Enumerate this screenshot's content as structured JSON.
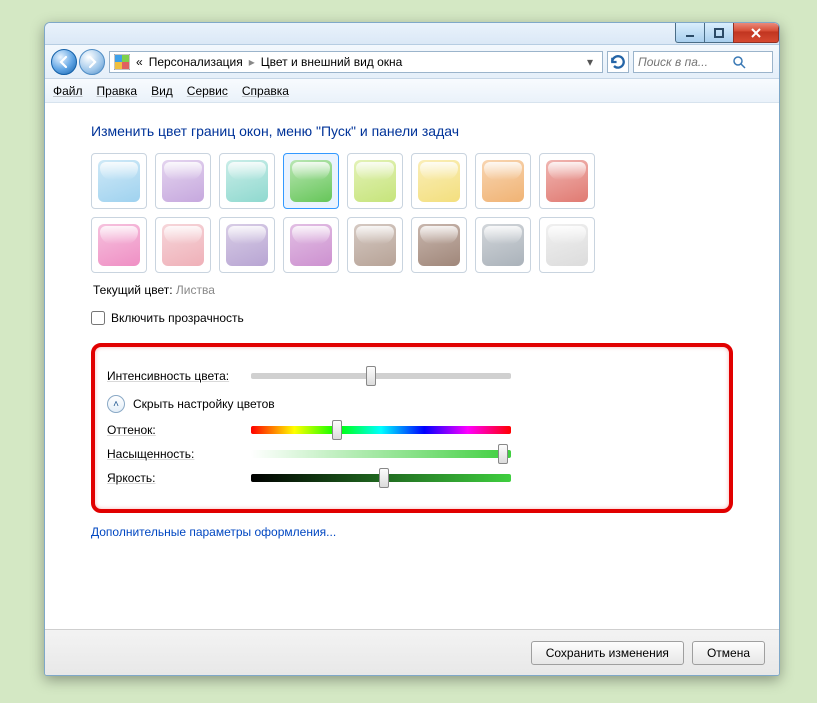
{
  "breadcrumb": {
    "prefix": "«",
    "parent": "Персонализация",
    "current": "Цвет и внешний вид окна"
  },
  "search": {
    "placeholder": "Поиск в па..."
  },
  "menu": {
    "file": "Файл",
    "edit": "Правка",
    "view": "Вид",
    "tools": "Сервис",
    "help": "Справка"
  },
  "heading": "Изменить цвет границ окон, меню \"Пуск\" и панели задач",
  "swatches_row1": [
    {
      "name": "sky",
      "color1": "#cfe9f7",
      "color2": "#9fd2ef"
    },
    {
      "name": "twilight",
      "color1": "#e4d4ef",
      "color2": "#c6a8de"
    },
    {
      "name": "sea",
      "color1": "#c9ede8",
      "color2": "#8fd9cf"
    },
    {
      "name": "leaf",
      "color1": "#b9e6b3",
      "color2": "#66c659",
      "selected": true
    },
    {
      "name": "lime",
      "color1": "#e3f2b7",
      "color2": "#c6e47b"
    },
    {
      "name": "sun",
      "color1": "#faeeb8",
      "color2": "#f3df7e"
    },
    {
      "name": "pumpkin",
      "color1": "#f8d5b1",
      "color2": "#f0b374"
    },
    {
      "name": "ruby",
      "color1": "#f0b5b1",
      "color2": "#e07a72"
    }
  ],
  "swatches_row2": [
    {
      "name": "fuchsia",
      "color1": "#f6c2de",
      "color2": "#ef8fc4"
    },
    {
      "name": "blush",
      "color1": "#f6d6da",
      "color2": "#efb0b8"
    },
    {
      "name": "violet",
      "color1": "#d8cde6",
      "color2": "#b8a5d3"
    },
    {
      "name": "lavender",
      "color1": "#e2bfe4",
      "color2": "#cd91d0"
    },
    {
      "name": "taupe",
      "color1": "#d5c9c2",
      "color2": "#b7a397"
    },
    {
      "name": "chocolate",
      "color1": "#c8b6ad",
      "color2": "#a0877a"
    },
    {
      "name": "slate",
      "color1": "#d2d6da",
      "color2": "#aab2ba"
    },
    {
      "name": "frost",
      "color1": "#f0f0f0",
      "color2": "#dcdcdc"
    }
  ],
  "current_color": {
    "label": "Текущий цвет:",
    "value": "Листва"
  },
  "transparency": {
    "label": "Включить прозрачность",
    "checked": false
  },
  "mixer": {
    "intensity": {
      "label": "Интенсивность цвета:",
      "value": 46
    },
    "toggle_label": "Скрыть настройку цветов",
    "hue": {
      "label": "Оттенок:",
      "value": 33
    },
    "saturation": {
      "label": "Насыщенность:",
      "value": 97
    },
    "brightness": {
      "label": "Яркость:",
      "value": 51
    }
  },
  "advanced_link": "Дополнительные параметры оформления...",
  "footer": {
    "save": "Сохранить изменения",
    "cancel": "Отмена"
  }
}
